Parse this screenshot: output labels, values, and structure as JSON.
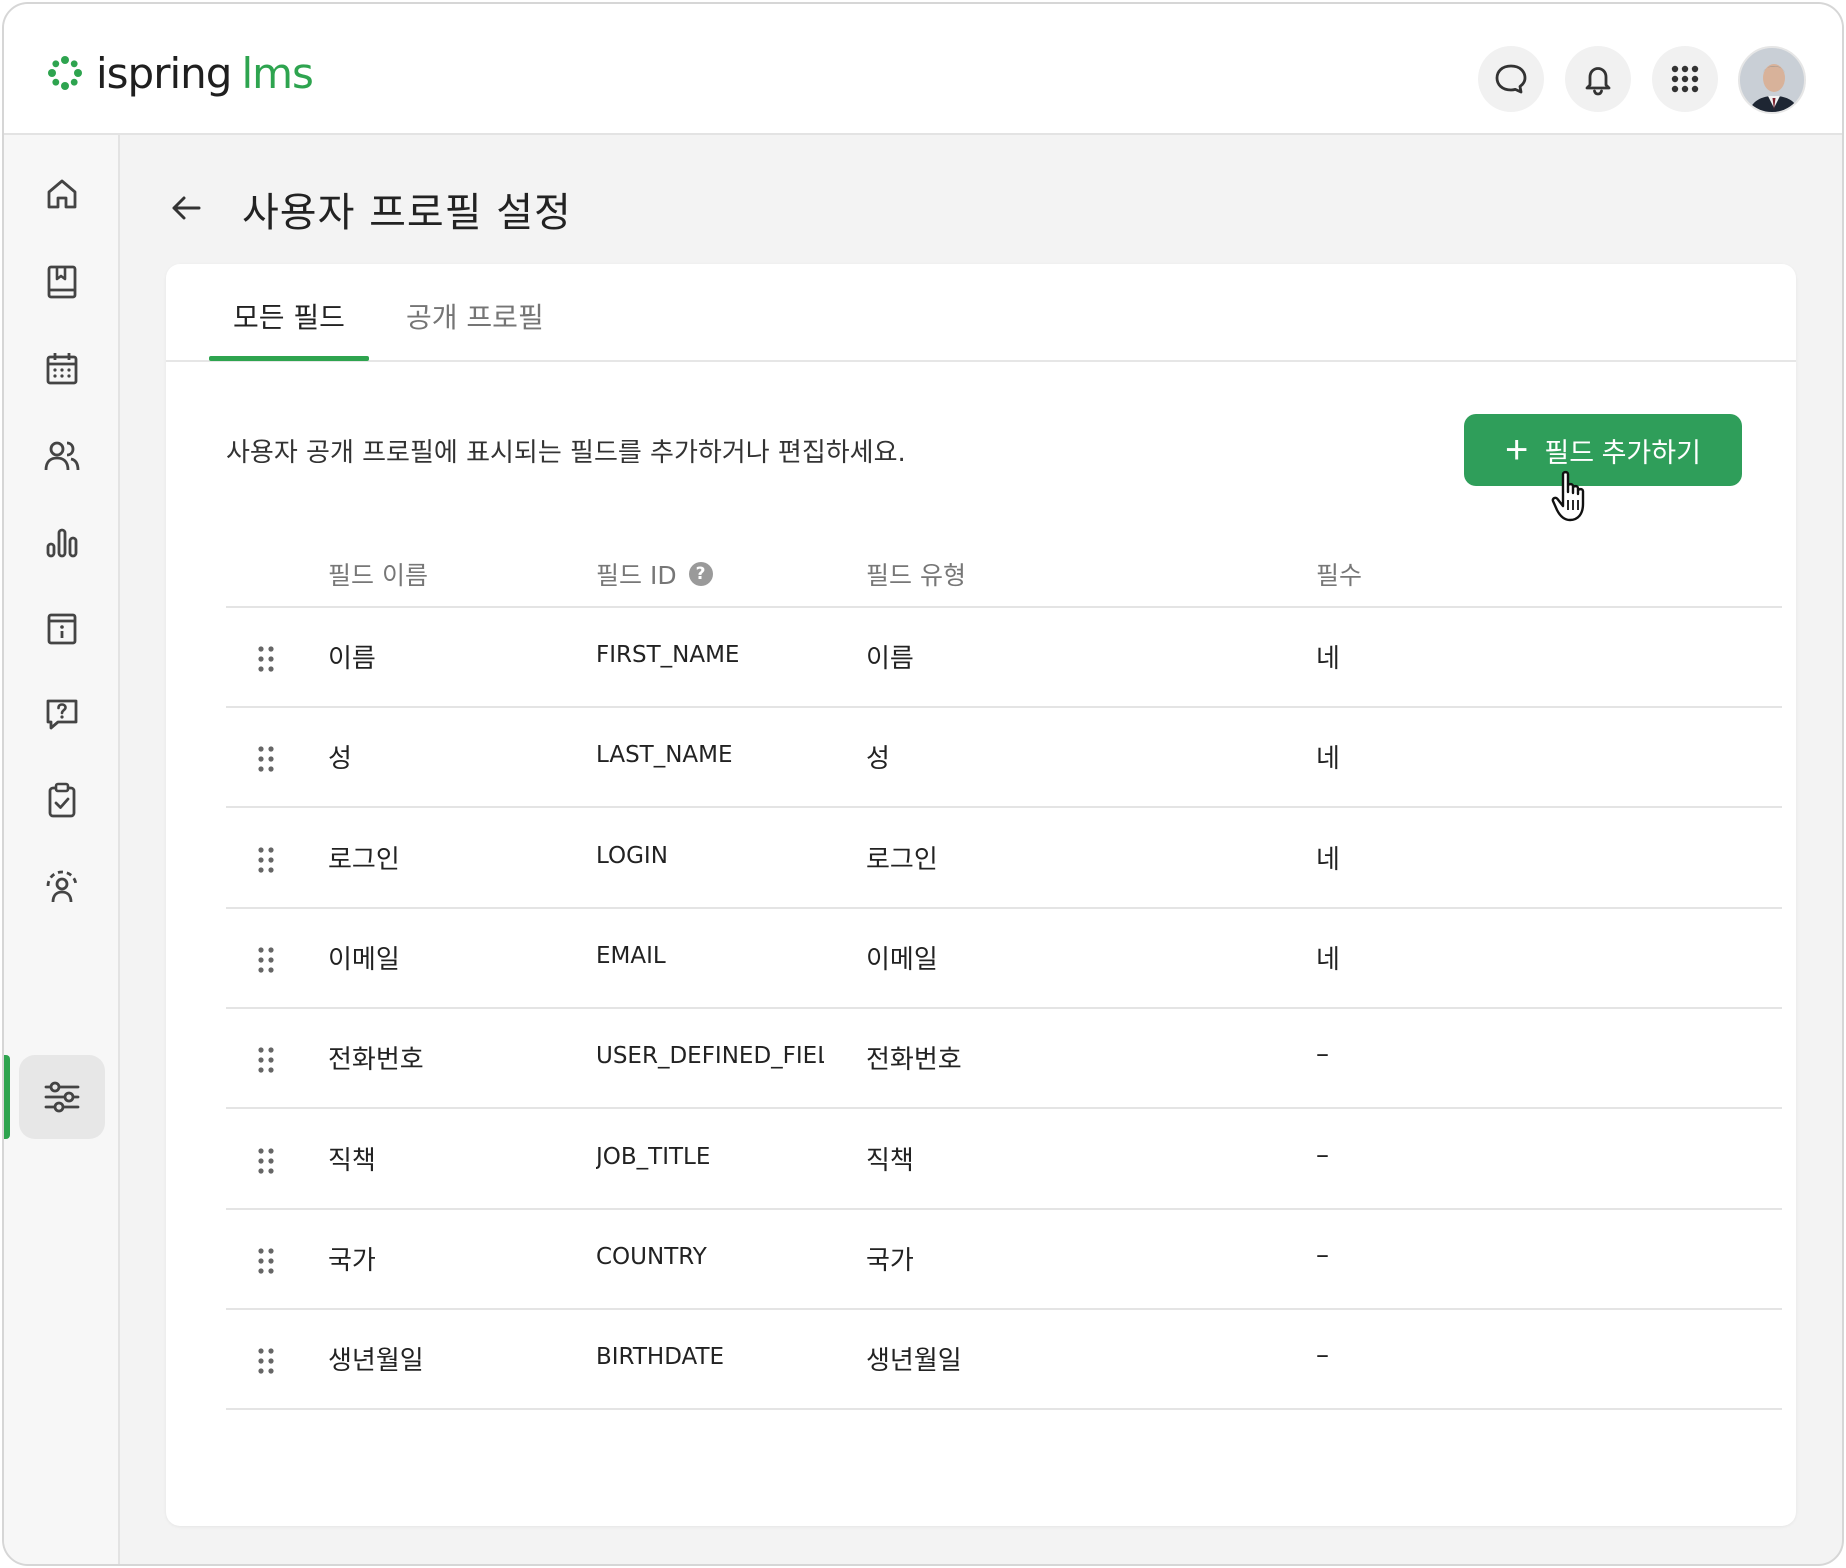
{
  "app": {
    "logo_part1": "ispring",
    "logo_part2": "lms",
    "brand_color": "#2ea44f"
  },
  "topbar": {
    "icons": [
      "chat-icon",
      "bell-icon",
      "apps-grid-icon"
    ]
  },
  "sidebar": {
    "items": [
      {
        "icon": "home-icon"
      },
      {
        "icon": "book-icon"
      },
      {
        "icon": "calendar-icon"
      },
      {
        "icon": "users-icon"
      },
      {
        "icon": "reports-icon"
      },
      {
        "icon": "info-icon"
      },
      {
        "icon": "question-icon"
      },
      {
        "icon": "clipboard-check-icon"
      },
      {
        "icon": "supervisor-icon"
      },
      {
        "icon": "settings-sliders-icon",
        "active": true
      }
    ]
  },
  "page": {
    "title": "사용자 프로필 설정",
    "tabs": [
      {
        "label": "모든 필드",
        "active": true
      },
      {
        "label": "공개 프로필",
        "active": false
      }
    ],
    "description": "사용자 공개 프로필에 표시되는 필드를 추가하거나 편집하세요.",
    "add_button_label": "필드 추가하기",
    "add_button_icon": "+"
  },
  "table": {
    "headers": {
      "name": "필드 이름",
      "id": "필드 ID",
      "type": "필드 유형",
      "required": "필수"
    },
    "rows": [
      {
        "name": "이름",
        "id": "FIRST_NAME",
        "type": "이름",
        "required": "네"
      },
      {
        "name": "성",
        "id": "LAST_NAME",
        "type": "성",
        "required": "네"
      },
      {
        "name": "로그인",
        "id": "LOGIN",
        "type": "로그인",
        "required": "네"
      },
      {
        "name": "이메일",
        "id": "EMAIL",
        "type": "이메일",
        "required": "네"
      },
      {
        "name": "전화번호",
        "id": "USER_DEFINED_FIELD",
        "type": "전화번호",
        "required": "–"
      },
      {
        "name": "직책",
        "id": "JOB_TITLE",
        "type": "직책",
        "required": "–"
      },
      {
        "name": "국가",
        "id": "COUNTRY",
        "type": "국가",
        "required": "–"
      },
      {
        "name": "생년월일",
        "id": "BIRTHDATE",
        "type": "생년월일",
        "required": "–"
      }
    ]
  }
}
